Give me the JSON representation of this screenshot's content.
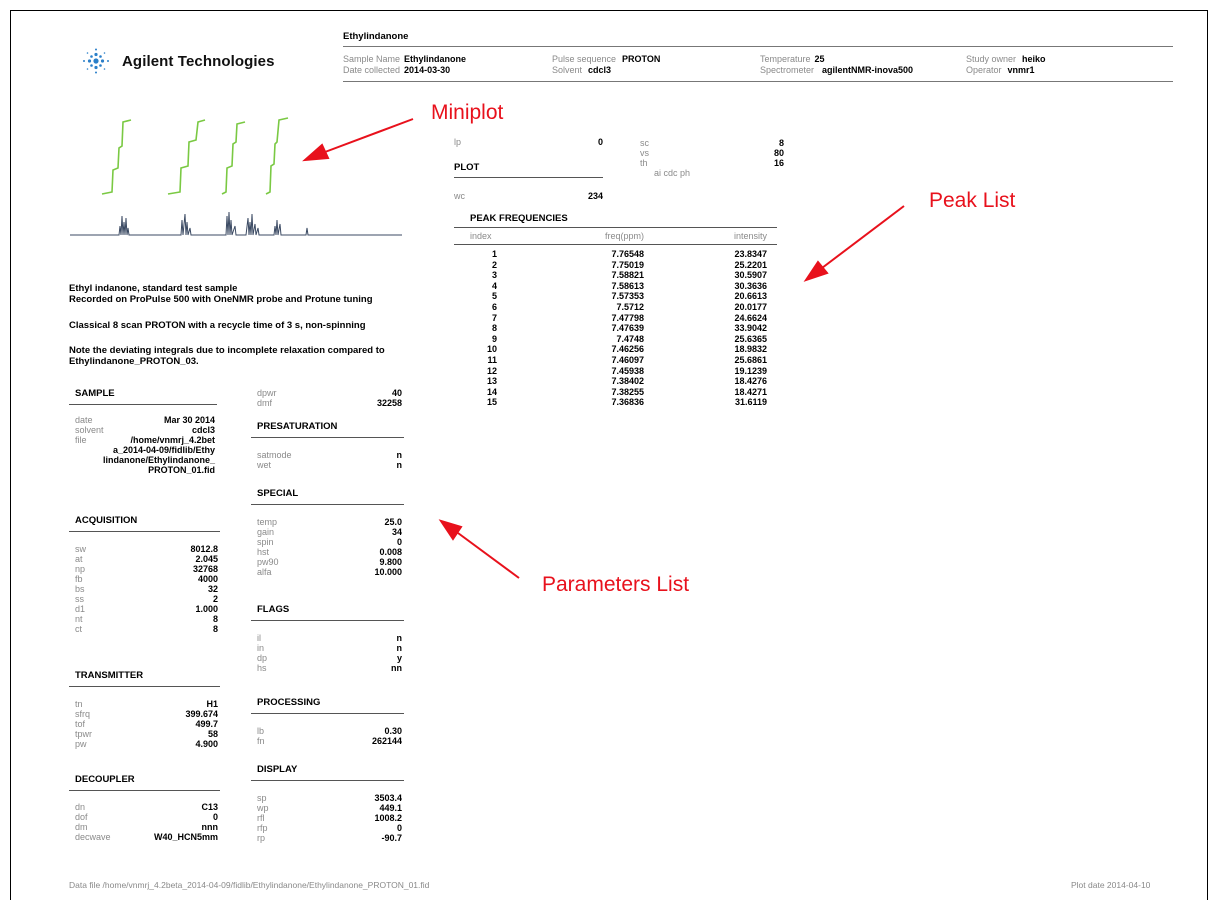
{
  "header": {
    "company": "Agilent Technologies",
    "title": "Ethylindanone",
    "fields": [
      {
        "label": "Sample Name",
        "value": "Ethylindanone"
      },
      {
        "label": "Date collected",
        "value": "2014-03-30"
      },
      {
        "label": "Pulse sequence",
        "value": "PROTON"
      },
      {
        "label": "Solvent",
        "value": "cdcl3"
      },
      {
        "label": "Temperature",
        "value": "25"
      },
      {
        "label": "Spectrometer",
        "value": "agilentNMR-inova500"
      },
      {
        "label": "Study owner",
        "value": "heiko"
      },
      {
        "label": "Operator",
        "value": "vnmr1"
      }
    ]
  },
  "annotations": {
    "miniplot": "Miniplot",
    "peak_list": "Peak List",
    "parameters_list": "Parameters List"
  },
  "description": {
    "line1": "Ethyl indanone, standard test sample",
    "line2": "Recorded on ProPulse 500 with OneNMR probe and Protune tuning",
    "line3": "Classical 8 scan PROTON with a recycle time of 3 s, non-spinning",
    "line4": "Note the deviating integrals due to incomplete relaxation compared to",
    "line5": "Ethylindanone_PROTON_03."
  },
  "plot_params": {
    "lp": {
      "k": "lp",
      "v": "0"
    },
    "title": "PLOT",
    "wc": {
      "k": "wc",
      "v": "234"
    },
    "sc": {
      "k": "sc",
      "v": "8"
    },
    "vs": {
      "k": "vs",
      "v": "80"
    },
    "th": {
      "k": "th",
      "v": "16"
    },
    "ai": "ai  cdc  ph"
  },
  "sample": {
    "title": "SAMPLE",
    "date": {
      "k": "date",
      "v": "Mar 30 2014"
    },
    "solvent": {
      "k": "solvent",
      "v": "cdcl3"
    },
    "file_k": "file",
    "file_l1": "/home/vnmrj_4.2bet",
    "file_l2": "a_2014-04-09/fidlib/Ethy",
    "file_l3": "lindanone/Ethylindanone_",
    "file_l4": "PROTON_01.fid"
  },
  "acquisition": {
    "title": "ACQUISITION",
    "rows": [
      {
        "k": "sw",
        "v": "8012.8"
      },
      {
        "k": "at",
        "v": "2.045"
      },
      {
        "k": "np",
        "v": "32768"
      },
      {
        "k": "fb",
        "v": "4000"
      },
      {
        "k": "bs",
        "v": "32"
      },
      {
        "k": "ss",
        "v": "2"
      },
      {
        "k": "d1",
        "v": "1.000"
      },
      {
        "k": "nt",
        "v": "8"
      },
      {
        "k": "ct",
        "v": "8"
      }
    ]
  },
  "transmitter": {
    "title": "TRANSMITTER",
    "rows": [
      {
        "k": "tn",
        "v": "H1"
      },
      {
        "k": "sfrq",
        "v": "399.674"
      },
      {
        "k": "tof",
        "v": "499.7"
      },
      {
        "k": "tpwr",
        "v": "58"
      },
      {
        "k": "pw",
        "v": "4.900"
      }
    ]
  },
  "decoupler": {
    "title": "DECOUPLER",
    "rows": [
      {
        "k": "dn",
        "v": "C13"
      },
      {
        "k": "dof",
        "v": "0"
      },
      {
        "k": "dm",
        "v": "nnn"
      },
      {
        "k": "decwave",
        "v": "W40_HCN5mm"
      }
    ]
  },
  "dec_extra": {
    "rows": [
      {
        "k": "dpwr",
        "v": "40"
      },
      {
        "k": "dmf",
        "v": "32258"
      }
    ]
  },
  "presaturation": {
    "title": "PRESATURATION",
    "rows": [
      {
        "k": "satmode",
        "v": "n"
      },
      {
        "k": "wet",
        "v": "n"
      }
    ]
  },
  "special": {
    "title": "SPECIAL",
    "rows": [
      {
        "k": "temp",
        "v": "25.0"
      },
      {
        "k": "gain",
        "v": "34"
      },
      {
        "k": "spin",
        "v": "0"
      },
      {
        "k": "hst",
        "v": "0.008"
      },
      {
        "k": "pw90",
        "v": "9.800"
      },
      {
        "k": "alfa",
        "v": "10.000"
      }
    ]
  },
  "flags": {
    "title": "FLAGS",
    "rows": [
      {
        "k": "il",
        "v": "n"
      },
      {
        "k": "in",
        "v": "n"
      },
      {
        "k": "dp",
        "v": "y"
      },
      {
        "k": "hs",
        "v": "nn"
      }
    ]
  },
  "processing": {
    "title": "PROCESSING",
    "rows": [
      {
        "k": "lb",
        "v": "0.30"
      },
      {
        "k": "fn",
        "v": "262144"
      }
    ]
  },
  "display": {
    "title": "DISPLAY",
    "rows": [
      {
        "k": "sp",
        "v": "3503.4"
      },
      {
        "k": "wp",
        "v": "449.1"
      },
      {
        "k": "rfl",
        "v": "1008.2"
      },
      {
        "k": "rfp",
        "v": "0"
      },
      {
        "k": "rp",
        "v": "-90.7"
      }
    ]
  },
  "peak_table": {
    "title": "PEAK FREQUENCIES",
    "columns": [
      "index",
      "freq(ppm)",
      "intensity"
    ],
    "rows": [
      [
        "1",
        "7.76548",
        "23.8347"
      ],
      [
        "2",
        "7.75019",
        "25.2201"
      ],
      [
        "3",
        "7.58821",
        "30.5907"
      ],
      [
        "4",
        "7.58613",
        "30.3636"
      ],
      [
        "5",
        "7.57353",
        "20.6613"
      ],
      [
        "6",
        "7.5712",
        "20.0177"
      ],
      [
        "7",
        "7.47798",
        "24.6624"
      ],
      [
        "8",
        "7.47639",
        "33.9042"
      ],
      [
        "9",
        "7.4748",
        "25.6365"
      ],
      [
        "10",
        "7.46256",
        "18.9832"
      ],
      [
        "11",
        "7.46097",
        "25.6861"
      ],
      [
        "12",
        "7.45938",
        "19.1239"
      ],
      [
        "13",
        "7.38402",
        "18.4276"
      ],
      [
        "14",
        "7.38255",
        "18.4271"
      ],
      [
        "15",
        "7.36836",
        "31.6119"
      ]
    ]
  },
  "footer": {
    "data_file": "Data file /home/vnmrj_4.2beta_2014-04-09/fidlib/Ethylindanone/Ethylindanone_PROTON_01.fid",
    "plot_date": "Plot date 2014-04-10"
  },
  "colors": {
    "annotation": "#e8111c",
    "integral": "#7ac943",
    "spectrum": "#3b4a63",
    "logo": "#2a7fc9"
  }
}
